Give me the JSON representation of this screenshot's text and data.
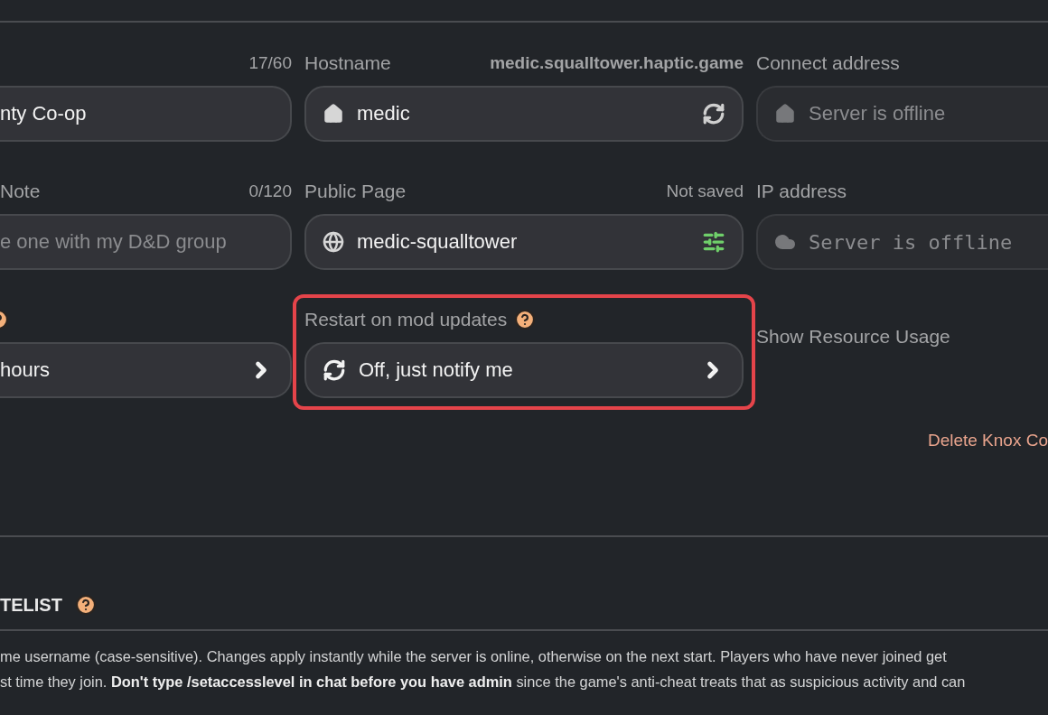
{
  "fields": [
    {
      "kind": "text",
      "note": "17/60",
      "note_strong": false,
      "value": "nty Co-op",
      "disabled": false
    },
    {
      "kind": "text",
      "label": "Hostname",
      "note": "medic.squalltower.haptic.game",
      "note_strong": true,
      "value": "medic",
      "disabled": false
    },
    {
      "kind": "text",
      "label": "Connect address",
      "placeholder": "Server is offline",
      "disabled": true
    },
    {
      "kind": "text",
      "label": "Note",
      "note": "0/120",
      "note_strong": false,
      "placeholder": "e one with my D&D group",
      "disabled": false
    },
    {
      "kind": "text",
      "label": "Public Page",
      "note": "Not saved",
      "note_strong": false,
      "value": "medic-squalltower",
      "disabled": false
    },
    {
      "kind": "address",
      "label": "IP address",
      "placeholder": "Server is offline",
      "disabled": true
    },
    {
      "kind": "select",
      "help": true,
      "value": "hours",
      "highlighted": false
    },
    {
      "kind": "select",
      "label": "Restart on mod updates",
      "help": true,
      "value": "Off, just notify me",
      "highlighted": true
    },
    {
      "kind": "label",
      "label": "Show Resource Usage"
    }
  ],
  "delete_link": "Delete Knox Co",
  "section": {
    "title": "TELIST",
    "help": true
  },
  "description": [
    "me username (case-sensitive). Changes apply instantly while the server is online, otherwise on the next start. Players who have never joined get",
    "st time they join. **Don't type /setaccesslevel in chat before you have admin** since the game's anti-cheat treats that as suspicious activity and can"
  ]
}
